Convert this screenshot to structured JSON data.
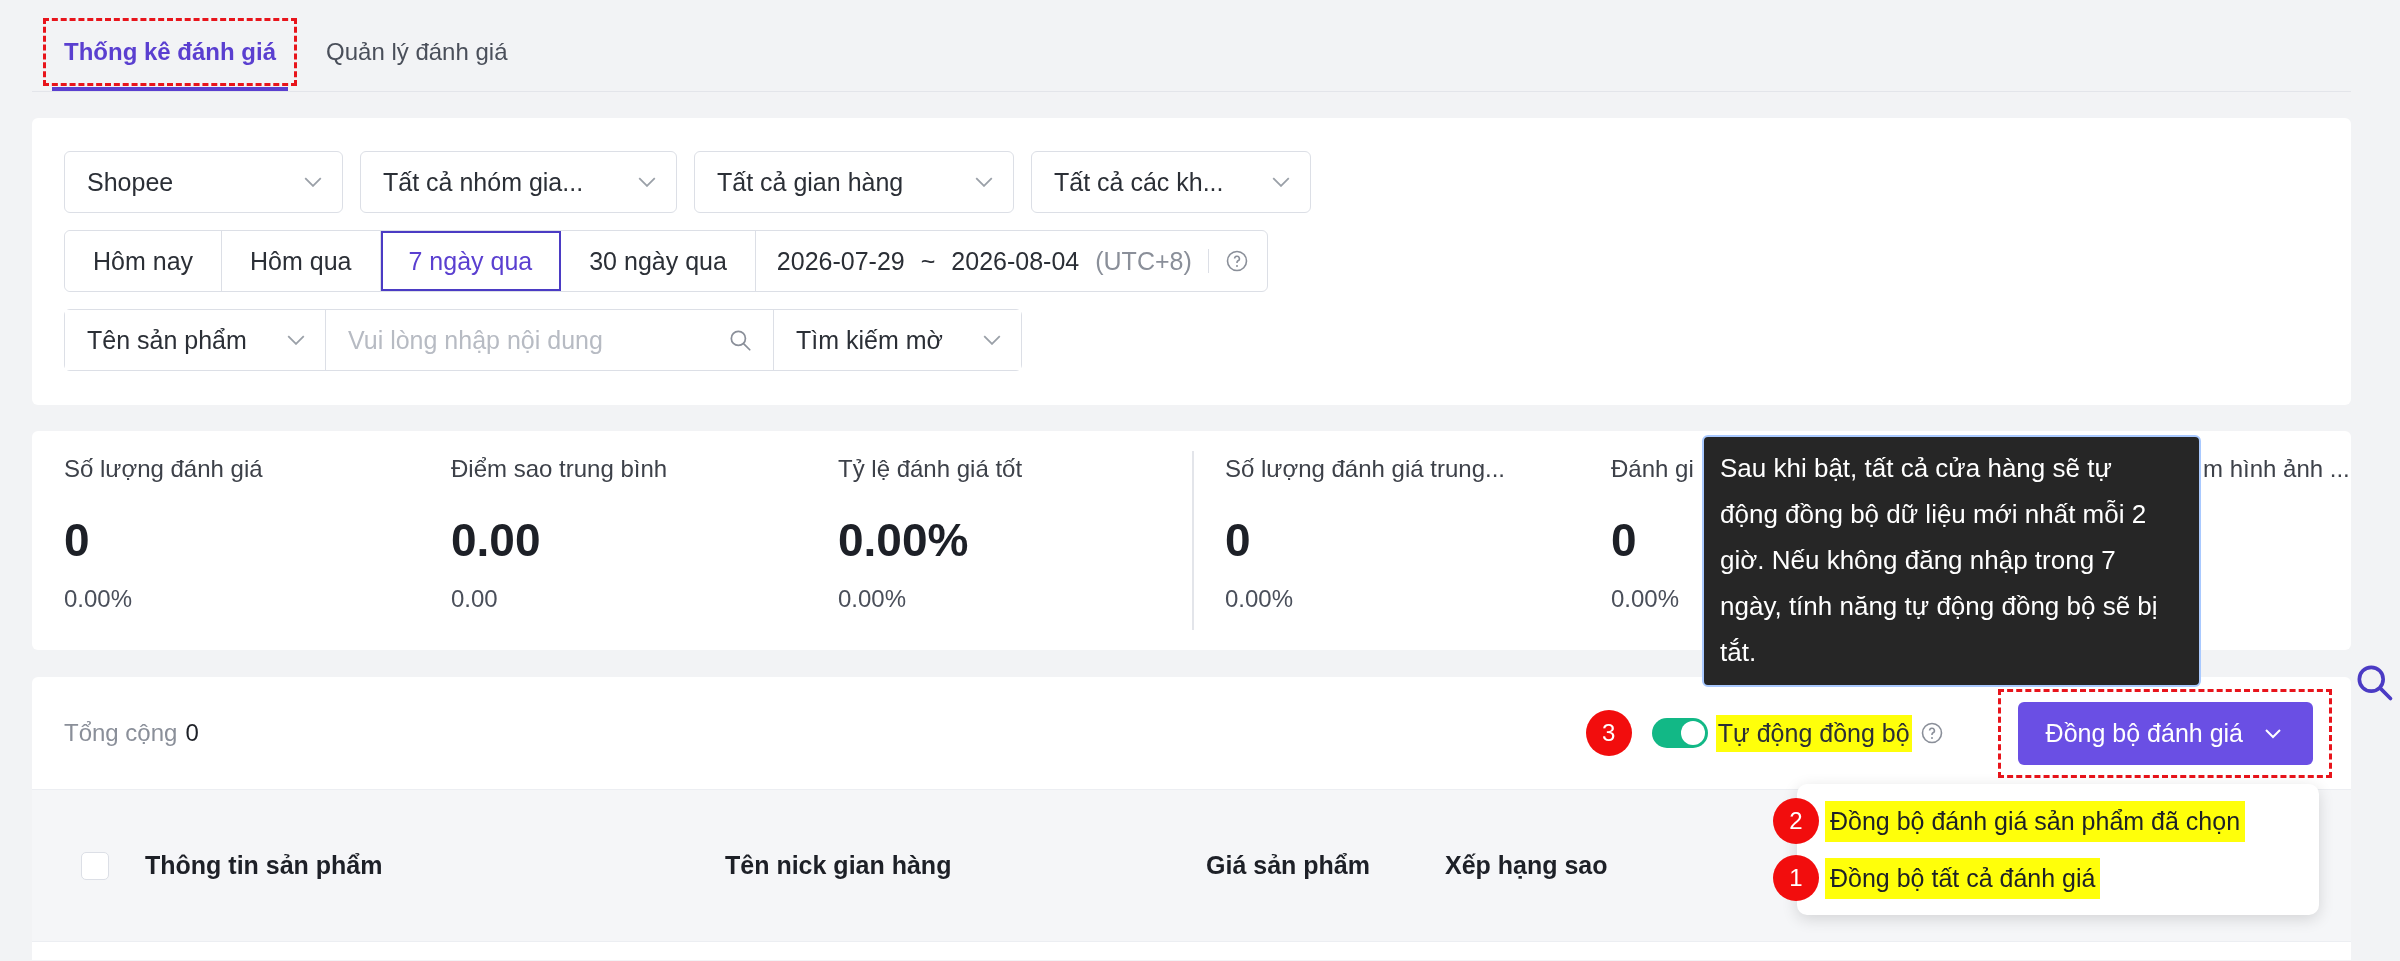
{
  "tabs": [
    {
      "label": "Thống kê đánh giá",
      "selected": true,
      "outlined": true
    },
    {
      "label": "Quản lý đánh giá",
      "selected": false,
      "outlined": false
    }
  ],
  "filters": {
    "selects": [
      {
        "value": "Shopee"
      },
      {
        "value": "Tất cả nhóm gia..."
      },
      {
        "value": "Tất cả gian hàng"
      },
      {
        "value": "Tất cả các kh..."
      }
    ],
    "date_presets": [
      {
        "label": "Hôm nay",
        "selected": false
      },
      {
        "label": "Hôm qua",
        "selected": false
      },
      {
        "label": "7 ngày qua",
        "selected": true
      },
      {
        "label": "30 ngày qua",
        "selected": false
      }
    ],
    "date_range": {
      "start": "2026-07-29",
      "separator": "~",
      "end": "2026-08-04",
      "timezone": "(UTC+8)"
    },
    "search": {
      "field": "Tên sản phẩm",
      "placeholder": "Vui lòng nhập nội dung",
      "mode": "Tìm kiếm mờ"
    }
  },
  "stat_groups": [
    [
      {
        "label": "Số lượng đánh giá",
        "value": "0",
        "sub": "0.00%"
      },
      {
        "label": "Điểm sao trung bình",
        "value": "0.00",
        "sub": "0.00"
      },
      {
        "label": "Tỷ lệ đánh giá tốt",
        "value": "0.00%",
        "sub": "0.00%"
      }
    ],
    [
      {
        "label": "Số lượng đánh giá trung...",
        "value": "0",
        "sub": "0.00%"
      },
      {
        "label": "Đánh gi",
        "value": "0",
        "sub": "0.00%"
      },
      {
        "label": "m hình ảnh ..."
      }
    ]
  ],
  "tooltip": {
    "text": "Sau khi bật, tất cả cửa hàng sẽ tự động đồng bộ dữ liệu mới nhất mỗi 2 giờ. Nếu không đăng nhập trong 7 ngày, tính năng tự động đồng bộ sẽ bị tắt."
  },
  "table": {
    "total_label": "Tổng cộng",
    "total": "0",
    "auto_sync": {
      "label": "Tự động đồng bộ",
      "on": true,
      "highlighted": true,
      "marker": "3"
    },
    "sync_button": {
      "label": "Đồng bộ đánh giá",
      "outlined": true
    },
    "sync_menu": [
      {
        "label": "Đồng bộ đánh giá sản phẩm đã chọn",
        "highlighted": true,
        "marker": "2"
      },
      {
        "label": "Đồng bộ tất cả đánh giá",
        "highlighted": true,
        "marker": "1"
      }
    ],
    "select_all": {
      "checked": false
    },
    "columns": [
      "Thông tin sản phẩm",
      "Tên nick gian hàng",
      "Giá sản phẩm",
      "Xếp hạng sao"
    ]
  }
}
